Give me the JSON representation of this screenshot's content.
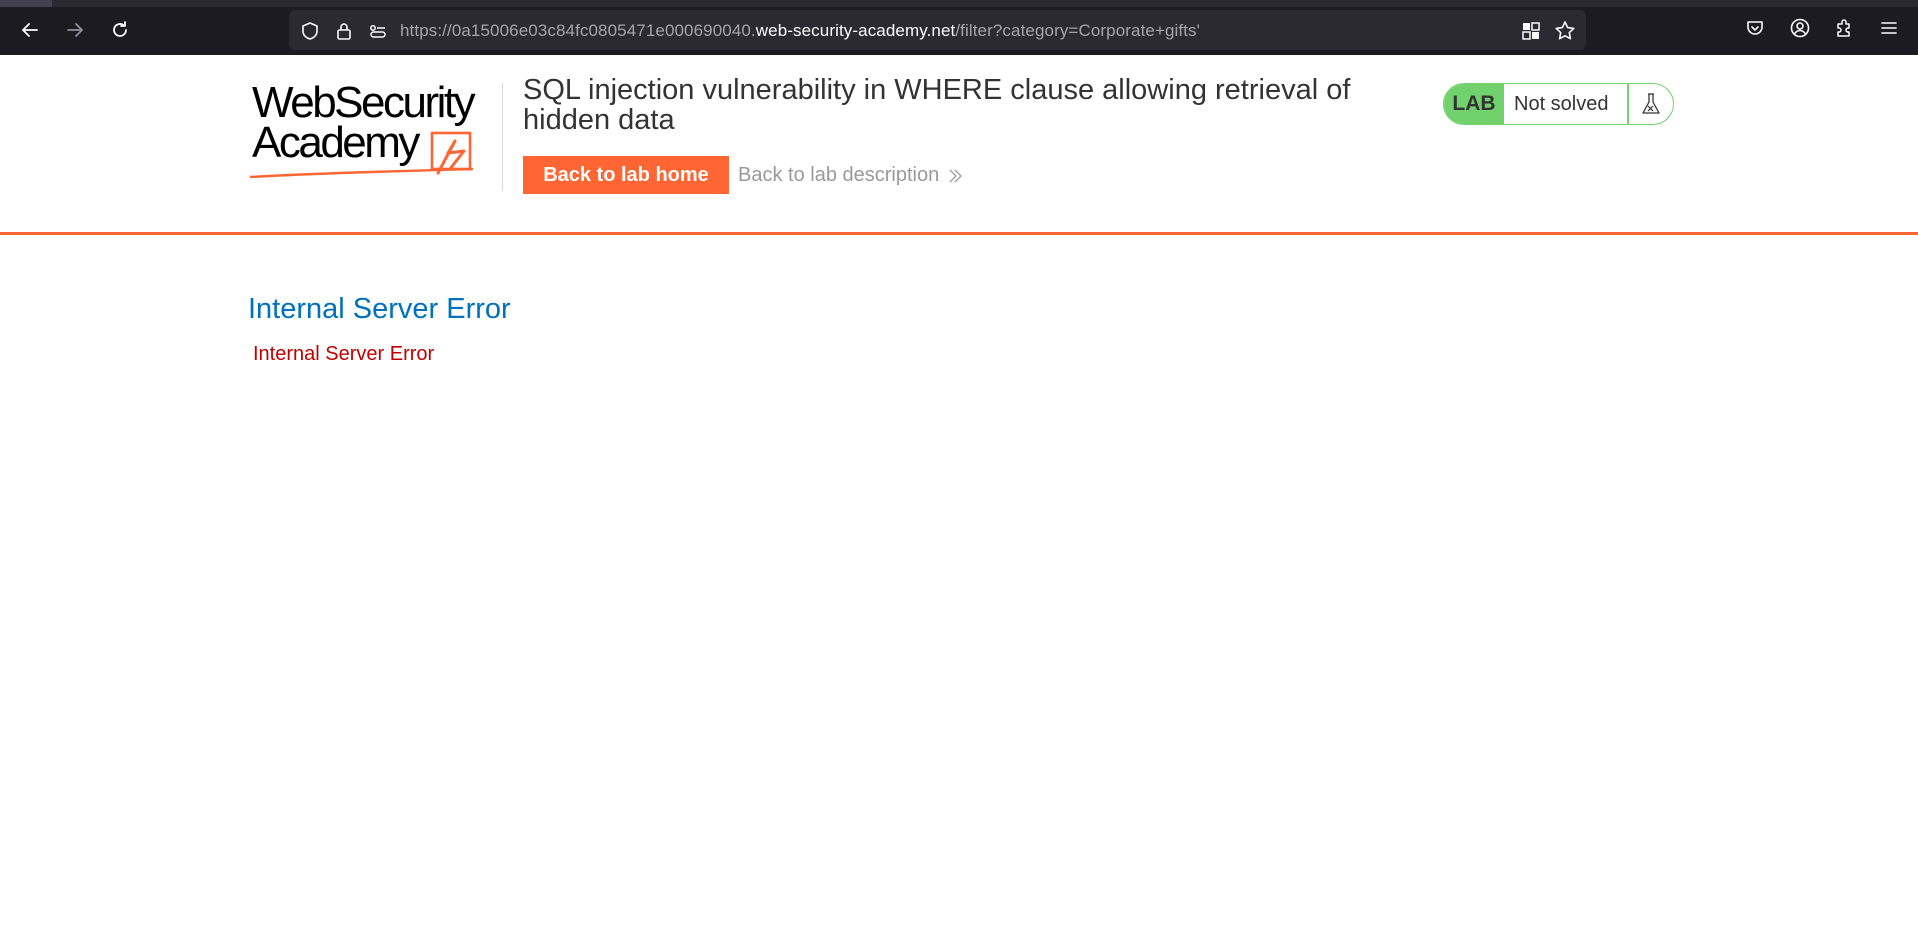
{
  "browser": {
    "url_prefix": "https://0a15006e03c84fc0805471e000690040.",
    "url_host": "web-security-academy.net",
    "url_path": "/filter?category=Corporate+gifts'"
  },
  "header": {
    "logo_line1": "WebSecurity",
    "logo_line2": "Academy",
    "lab_title": "SQL injection vulnerability in WHERE clause allowing retrieval of hidden data",
    "back_home_label": "Back to lab home",
    "back_description_label": "Back to lab description",
    "lab_badge": "LAB",
    "status_label": "Not solved"
  },
  "main": {
    "heading": "Internal Server Error",
    "message": "Internal Server Error"
  },
  "colors": {
    "accent": "#ff6633",
    "lab_green": "#70d16d",
    "heading_blue": "#0071bc",
    "error_red": "#c00000"
  }
}
